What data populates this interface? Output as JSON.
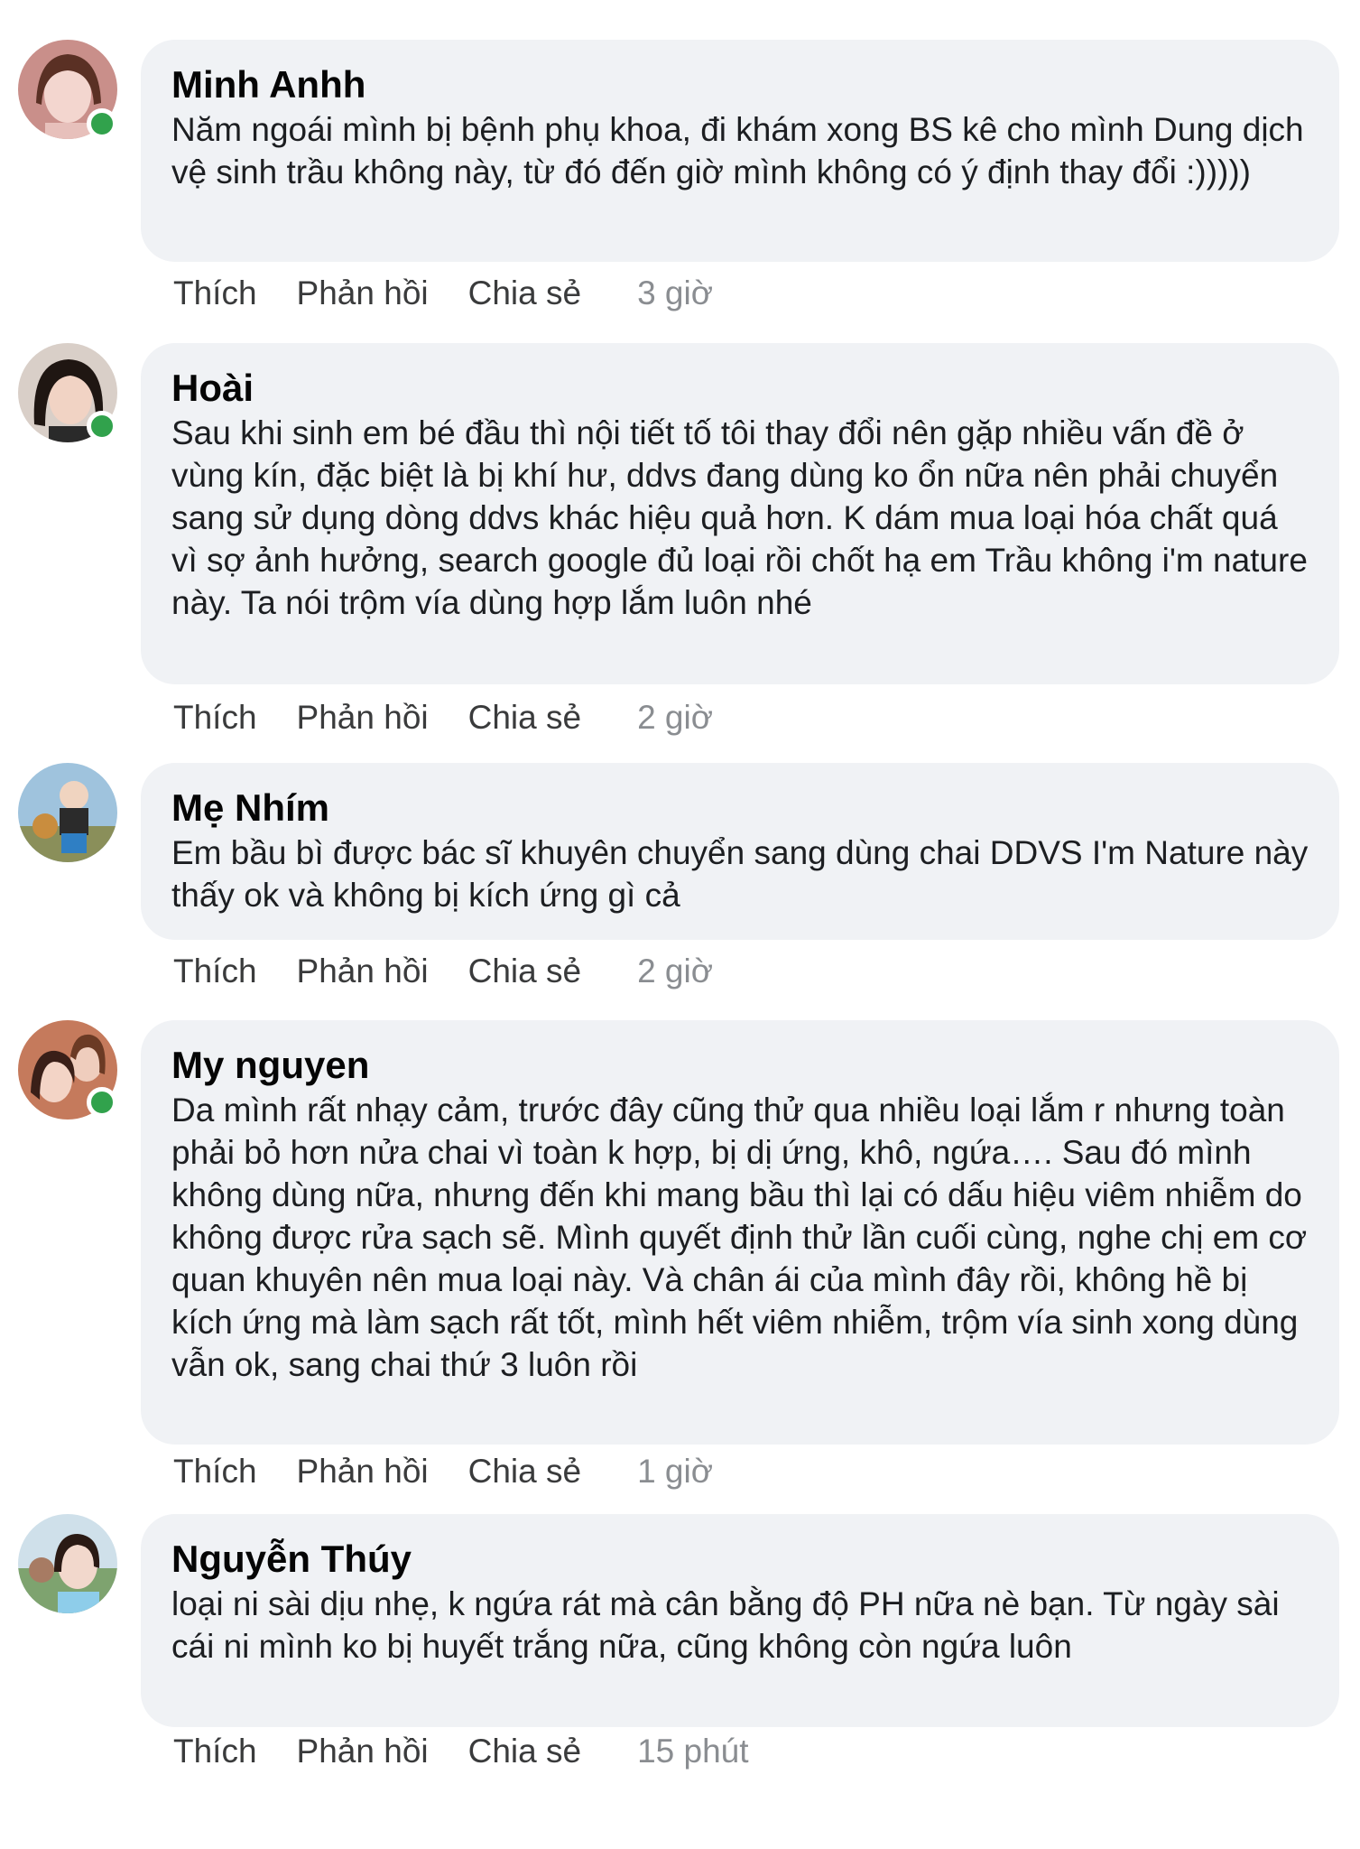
{
  "actions": {
    "like": "Thích",
    "reply": "Phản hồi",
    "share": "Chia sẻ"
  },
  "comments": [
    {
      "author": "Minh Anhh",
      "text": "Năm ngoái mình bị bệnh phụ khoa, đi khám xong BS kê cho mình Dung dịch vệ sinh trầu không này, từ đó đến giờ mình không có ý định thay đổi :)))))",
      "time": "3 giờ",
      "online": true
    },
    {
      "author": "Hoài",
      "text": "Sau khi sinh em bé đầu thì nội tiết tố tôi thay đổi nên gặp nhiều vấn đề ở vùng kín, đặc biệt là bị khí hư, ddvs đang dùng ko ổn nữa nên phải chuyển sang sử dụng dòng ddvs khác hiệu quả hơn. K dám mua loại hóa chất quá vì sợ ảnh hưởng, search google đủ loại rồi chốt hạ em Trầu không i'm nature này. Ta nói trộm vía dùng hợp lắm luôn nhé",
      "time": "2 giờ",
      "online": true
    },
    {
      "author": "Mẹ Nhím",
      "text": "Em bầu bì được bác sĩ khuyên chuyển sang dùng chai DDVS I'm Nature này thấy ok và không bị kích ứng gì cả",
      "time": "2 giờ",
      "online": false
    },
    {
      "author": "My nguyen",
      "text": "Da mình rất nhạy cảm, trước đây cũng thử qua nhiều loại lắm r nhưng toàn phải bỏ hơn nửa chai vì toàn k hợp, bị dị ứng, khô, ngứa…. Sau đó mình không dùng nữa, nhưng đến khi mang bầu thì lại có dấu hiệu viêm nhiễm do không được rửa sạch sẽ. Mình quyết định thử lần cuối cùng, nghe chị em cơ quan khuyên nên mua loại này. Và chân ái của mình đây rồi, không hề bị kích ứng mà làm sạch rất tốt, mình hết viêm nhiễm, trộm vía sinh xong dùng vẫn ok, sang chai thứ 3 luôn rồi",
      "time": "1 giờ",
      "online": true
    },
    {
      "author": "Nguyễn Thúy",
      "text": "loại ni sài dịu nhẹ, k ngứa rát mà cân bằng độ PH nữa nè bạn. Từ ngày sài cái ni mình ko bị huyết trắng nữa, cũng không còn ngứa luôn",
      "time": "15 phút",
      "online": false
    }
  ],
  "colors": {
    "bubble_bg": "#f0f2f5",
    "online": "#31a24c",
    "timestamp": "#8a8d91"
  }
}
